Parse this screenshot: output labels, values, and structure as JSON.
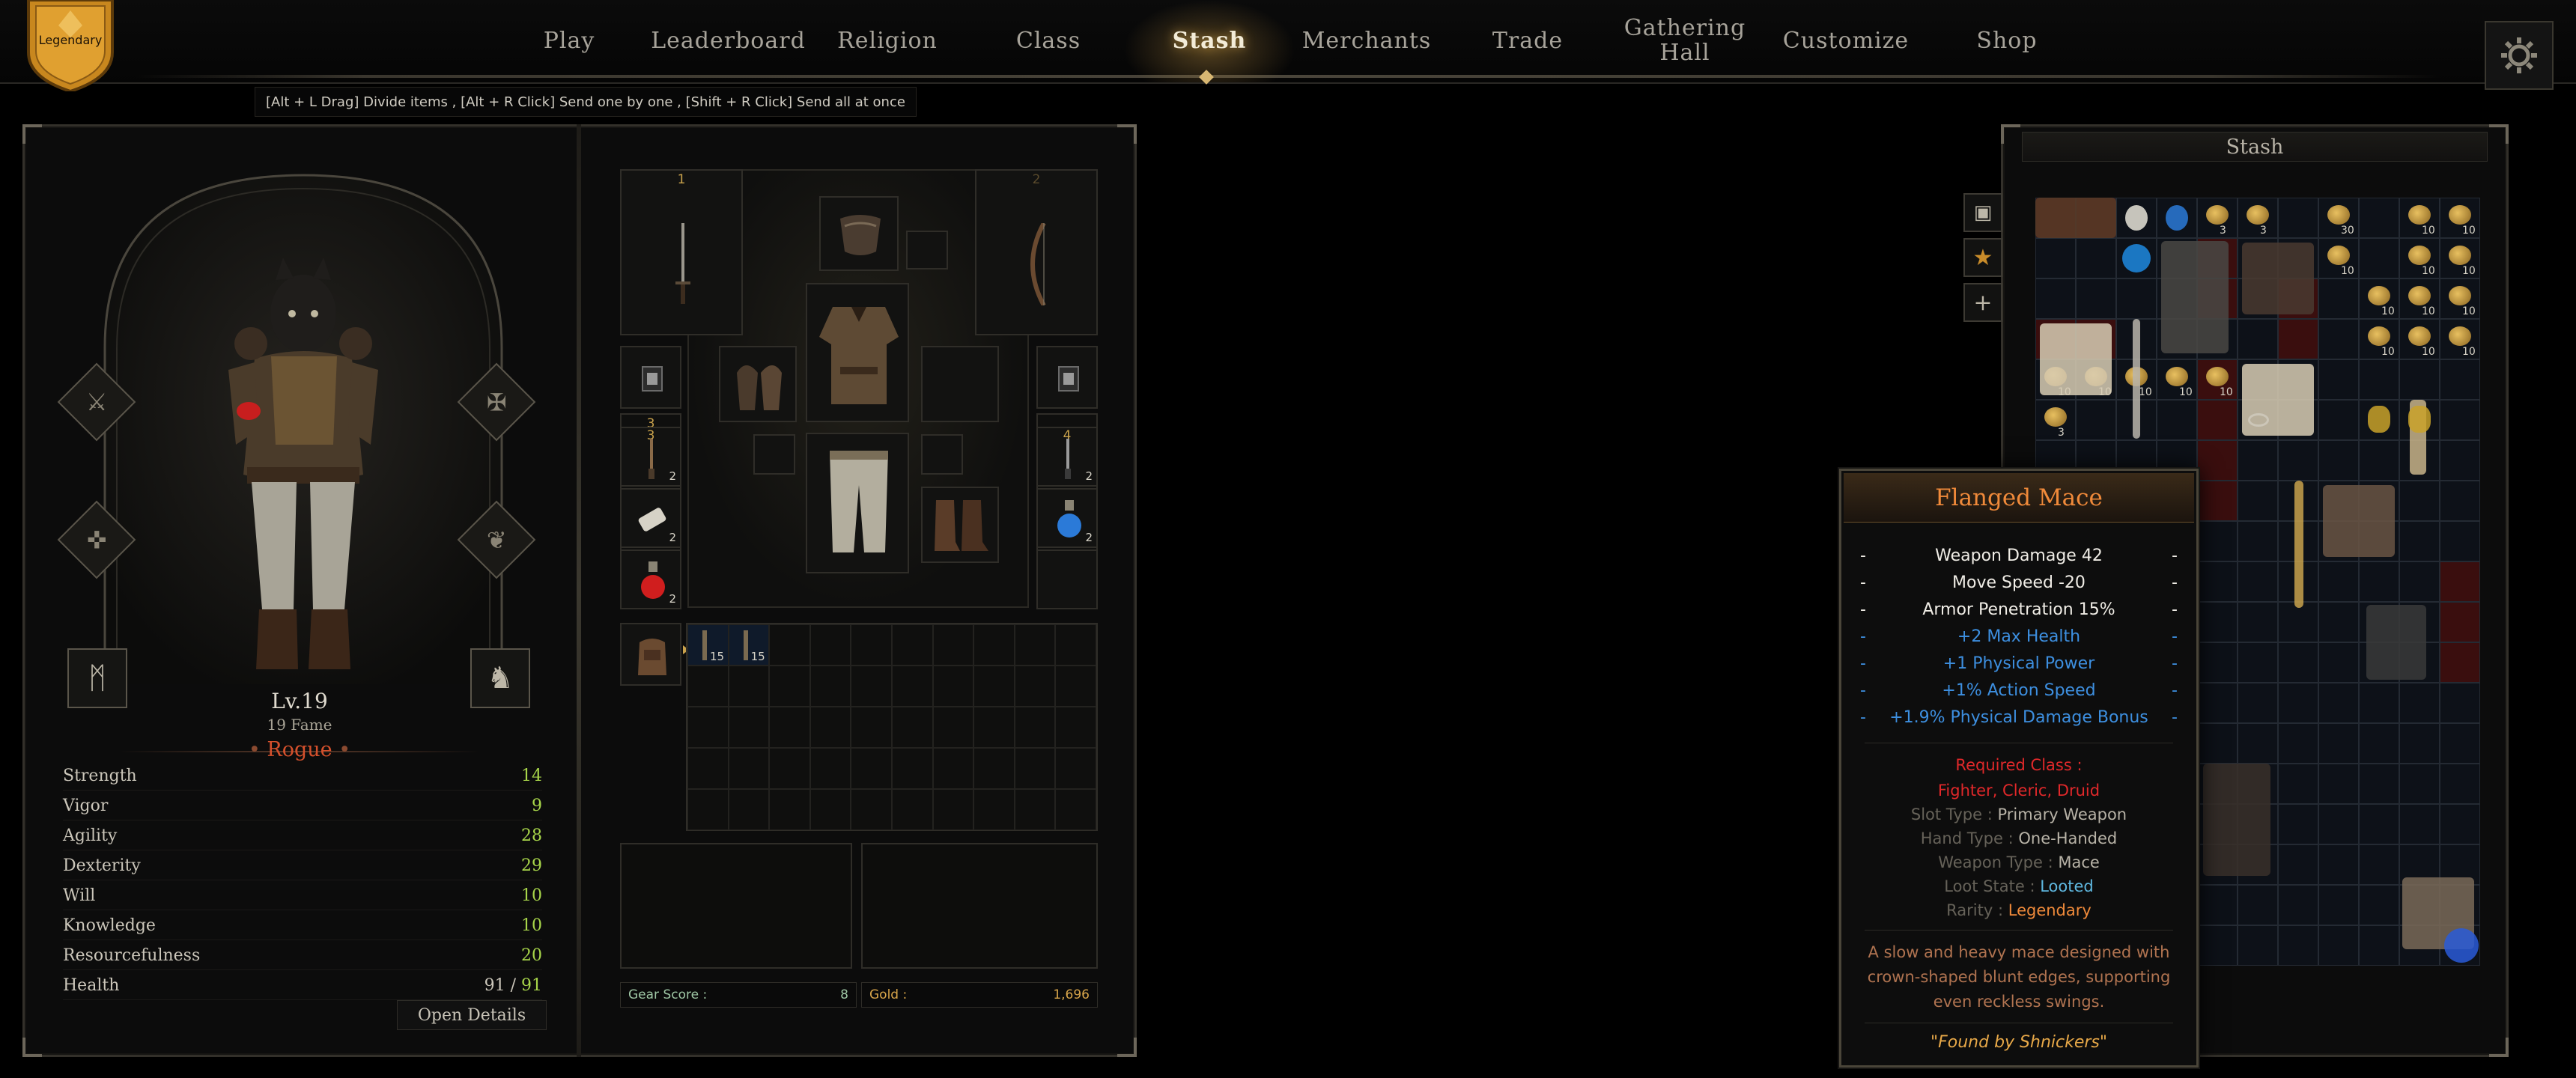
{
  "nav": {
    "items": [
      {
        "label": "Play"
      },
      {
        "label": "Leaderboard"
      },
      {
        "label": "Religion"
      },
      {
        "label": "Class"
      },
      {
        "label": "Stash"
      },
      {
        "label": "Merchants"
      },
      {
        "label": "Trade"
      },
      {
        "label": "Gathering Hall"
      },
      {
        "label": "Customize"
      },
      {
        "label": "Shop"
      }
    ],
    "active": "Stash",
    "rank_badge": "Legendary"
  },
  "hint": "[Alt + L Drag] Divide items , [Alt + R Click] Send one by one , [Shift + R Click] Send all at once",
  "character": {
    "level": "Lv.19",
    "fame": "19 Fame",
    "class": "Rogue",
    "stats": [
      {
        "name": "Strength",
        "value": "14"
      },
      {
        "name": "Vigor",
        "value": "9"
      },
      {
        "name": "Agility",
        "value": "28"
      },
      {
        "name": "Dexterity",
        "value": "29"
      },
      {
        "name": "Will",
        "value": "10"
      },
      {
        "name": "Knowledge",
        "value": "10"
      },
      {
        "name": "Resourcefulness",
        "value": "20"
      }
    ],
    "health": {
      "name": "Health",
      "current": "91",
      "separator": "/",
      "max": "91"
    },
    "open_details": "Open Details"
  },
  "loadout": {
    "slot_numbers": {
      "s1": "1",
      "s2": "2",
      "s3": "3",
      "s4": "4"
    },
    "quantities": {
      "q1": "2",
      "q2": "2",
      "q3": "2",
      "q4": "2",
      "q5": "2",
      "bag1": "15",
      "bag2": "15"
    },
    "gear_score_label": "Gear Score :",
    "gear_score": "8",
    "gold_label": "Gold :",
    "gold": "1,696"
  },
  "stash": {
    "title": "Stash",
    "tab_add": "+",
    "quantities": [
      "3",
      "3",
      "30",
      "10",
      "10",
      "10",
      "10",
      "10",
      "10",
      "10",
      "10",
      "10",
      "10",
      "10",
      "10",
      "10",
      "10",
      "10",
      "10",
      "3"
    ]
  },
  "tooltip": {
    "name": "Flanged Mace",
    "dash": "-",
    "base_stats": [
      "Weapon Damage 42",
      "Move Speed -20",
      "Armor Penetration 15%"
    ],
    "bonus_stats": [
      "+2 Max Health",
      "+1 Physical Power",
      "+1% Action Speed",
      "+1.9% Physical Damage Bonus"
    ],
    "required_class_label": "Required Class :",
    "required_classes": "Fighter, Cleric, Druid",
    "slot_type_label": "Slot Type :",
    "slot_type": "Primary Weapon",
    "hand_type_label": "Hand Type :",
    "hand_type": "One-Handed",
    "weapon_type_label": "Weapon Type :",
    "weapon_type": "Mace",
    "loot_state_label": "Loot State :",
    "loot_state": "Looted",
    "rarity_label": "Rarity :",
    "rarity": "Legendary",
    "description": "A slow and heavy mace designed with crown-shaped blunt edges, supporting even reckless swings.",
    "found_by": "\"Found by Shnickers\""
  },
  "colors": {
    "legendary": "#f08a3a",
    "stat_green": "#a8d64a",
    "bonus_blue": "#3d8fe0",
    "required_red": "#e0282a",
    "loot_state": "#5fb8e0"
  }
}
